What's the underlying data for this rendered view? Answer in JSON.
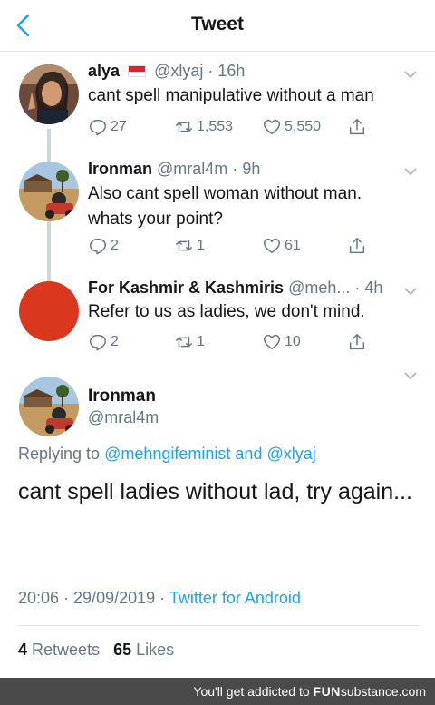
{
  "header": {
    "title": "Tweet"
  },
  "tweets": [
    {
      "name": "alya",
      "handle": "@xlyaj",
      "time": "· 16h",
      "text": "cant spell manipulative without a man",
      "replies": "27",
      "retweets": "1,553",
      "likes": "5,550"
    },
    {
      "name": "Ironman",
      "handle": "@mral4m",
      "time": "· 9h",
      "text": "Also cant spell woman without man. whats your point?",
      "replies": "2",
      "retweets": "1",
      "likes": "61"
    },
    {
      "name": "For Kashmir & Kashmiris",
      "handle": "@meh...",
      "time": "· 4h",
      "text": "Refer to us as ladies, we don't mind.",
      "replies": "2",
      "retweets": "1",
      "likes": "10",
      "avatar_color": "#d9381e"
    }
  ],
  "focus": {
    "name": "Ironman",
    "handle": "@mral4m",
    "replying_prefix": "Replying to",
    "replying_user1": "@mehngifeminist",
    "replying_and": "and",
    "replying_user2": "@xlyaj",
    "text": "cant spell ladies without lad, try again...",
    "timestamp": "20:06 · 29/09/2019 ·",
    "source": "Twitter for Android",
    "retweets_count": "4",
    "retweets_label": "Retweets",
    "likes_count": "65",
    "likes_label": "Likes"
  },
  "footer": {
    "prefix": "You'll get addicted to",
    "brand_bold": "FUN",
    "brand_rest": "substance",
    "suffix": ".com"
  },
  "colors": {
    "accent": "#1da1f2",
    "muted": "#657786",
    "text": "#14171a",
    "divider": "#e1e8ed"
  }
}
